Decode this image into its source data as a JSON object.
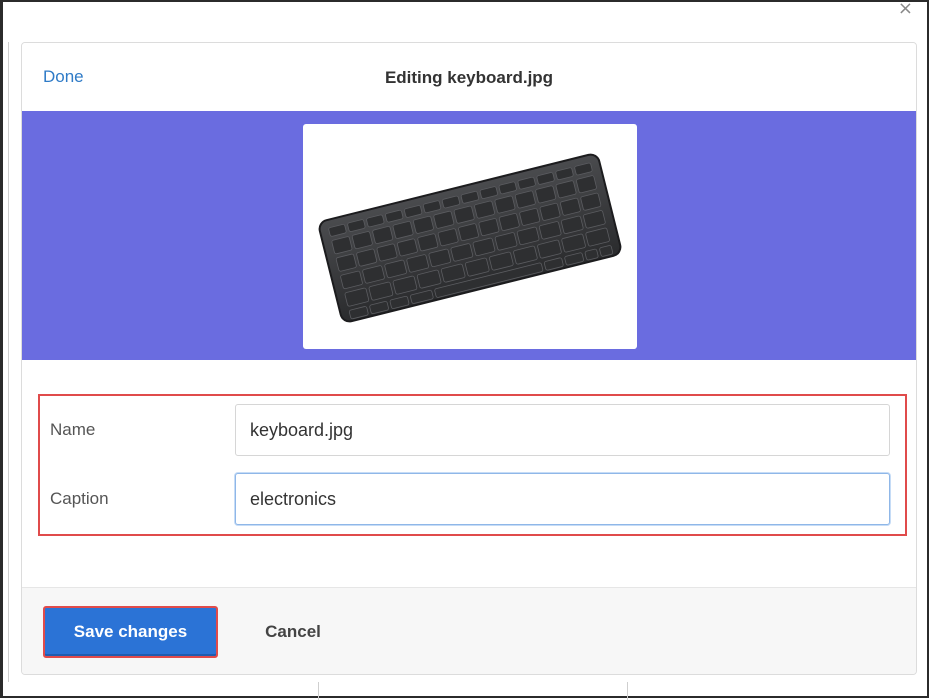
{
  "dialog": {
    "title": "Editing keyboard.jpg",
    "done_label": "Done",
    "close_glyph": "×"
  },
  "preview": {
    "image_subject": "keyboard",
    "band_color": "#6a6ce0"
  },
  "form": {
    "name_label": "Name",
    "name_value": "keyboard.jpg",
    "caption_label": "Caption",
    "caption_value": "electronics"
  },
  "footer": {
    "save_label": "Save changes",
    "cancel_label": "Cancel"
  },
  "colors": {
    "accent": "#2b73d6",
    "link": "#2f7bc7",
    "highlight": "#e04b4b"
  }
}
